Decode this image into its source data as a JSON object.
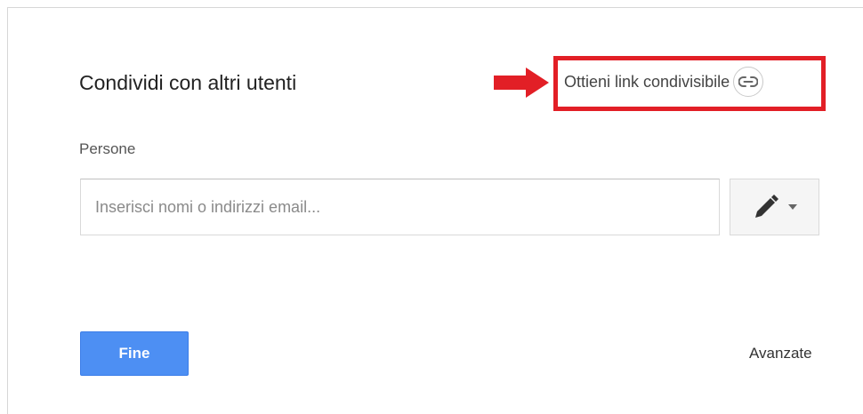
{
  "dialog": {
    "title": "Condividi con altri utenti",
    "get_link_label": "Ottieni link condivisibile",
    "people_label": "Persone",
    "email_input": {
      "placeholder": "Inserisci nomi o indirizzi email...",
      "value": ""
    },
    "permission_button": {
      "icon": "pencil-icon",
      "dropdown_icon": "caret-down-icon"
    },
    "done_label": "Fine",
    "advanced_label": "Avanzate"
  },
  "annotation": {
    "arrow_color": "#e21f26",
    "highlight_color": "#e21f26"
  },
  "colors": {
    "primary_button": "#4d8ff3",
    "text": "#222222",
    "secondary_text": "#555555",
    "border": "#d9d9d9"
  }
}
